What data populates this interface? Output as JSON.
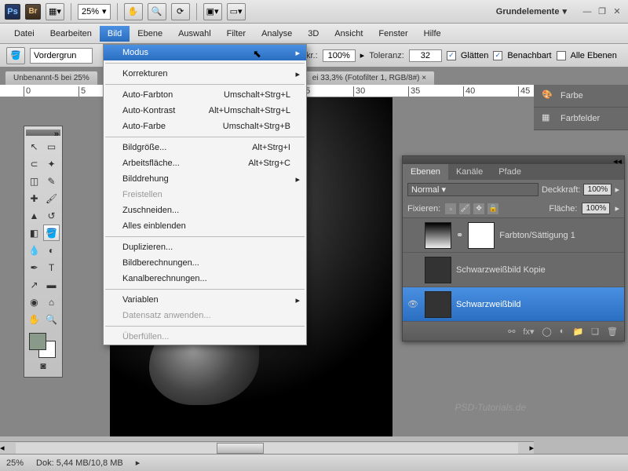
{
  "topbar": {
    "zoom": "25%",
    "workspace": "Grundelemente"
  },
  "menu": {
    "items": [
      "Datei",
      "Bearbeiten",
      "Bild",
      "Ebene",
      "Auswahl",
      "Filter",
      "Analyse",
      "3D",
      "Ansicht",
      "Fenster",
      "Hilfe"
    ],
    "open_index": 2
  },
  "dropdown": [
    {
      "t": "hl",
      "label": "Modus",
      "arrow": true
    },
    {
      "t": "sep"
    },
    {
      "t": "item",
      "label": "Korrekturen",
      "arrow": true
    },
    {
      "t": "sep"
    },
    {
      "t": "item",
      "label": "Auto-Farbton",
      "accel": "Umschalt+Strg+L"
    },
    {
      "t": "item",
      "label": "Auto-Kontrast",
      "accel": "Alt+Umschalt+Strg+L"
    },
    {
      "t": "item",
      "label": "Auto-Farbe",
      "accel": "Umschalt+Strg+B"
    },
    {
      "t": "sep"
    },
    {
      "t": "item",
      "label": "Bildgröße...",
      "accel": "Alt+Strg+I"
    },
    {
      "t": "item",
      "label": "Arbeitsfläche...",
      "accel": "Alt+Strg+C"
    },
    {
      "t": "item",
      "label": "Bilddrehung",
      "arrow": true
    },
    {
      "t": "disabled",
      "label": "Freistellen"
    },
    {
      "t": "item",
      "label": "Zuschneiden..."
    },
    {
      "t": "item",
      "label": "Alles einblenden"
    },
    {
      "t": "sep"
    },
    {
      "t": "item",
      "label": "Duplizieren..."
    },
    {
      "t": "item",
      "label": "Bildberechnungen..."
    },
    {
      "t": "item",
      "label": "Kanalberechnungen..."
    },
    {
      "t": "sep"
    },
    {
      "t": "item",
      "label": "Variablen",
      "arrow": true
    },
    {
      "t": "disabled",
      "label": "Datensatz anwenden..."
    },
    {
      "t": "sep"
    },
    {
      "t": "disabled",
      "label": "Überfüllen..."
    }
  ],
  "optbar": {
    "field1": "Vordergrun",
    "opacity_label": "kr.:",
    "opacity": "100%",
    "tol_label": "Toleranz:",
    "tol": "32",
    "glatten": "Glätten",
    "benachbart": "Benachbart",
    "alle": "Alle Ebenen"
  },
  "tabs": [
    "Unbenannt-5 bei 25%",
    "ei 33,3% (Fotofilter 1, RGB/8#) ×"
  ],
  "right": {
    "farbe": "Farbe",
    "farbfelder": "Farbfelder"
  },
  "layers": {
    "tabs": [
      "Ebenen",
      "Kanäle",
      "Pfade"
    ],
    "blend": "Normal",
    "opacity_label": "Deckkraft:",
    "opacity": "100%",
    "lock_label": "Fixieren:",
    "fill_label": "Fläche:",
    "fill": "100%",
    "items": [
      {
        "name": "Farbton/Sättigung 1",
        "type": "adj",
        "visible": false
      },
      {
        "name": "Schwarzweißbild Kopie",
        "type": "img",
        "visible": false
      },
      {
        "name": "Schwarzweißbild",
        "type": "img",
        "visible": true,
        "selected": true
      }
    ]
  },
  "status": {
    "zoom": "25%",
    "doc": "Dok: 5,44 MB/10,8 MB"
  },
  "watermark": "PSD-Tutorials.de"
}
